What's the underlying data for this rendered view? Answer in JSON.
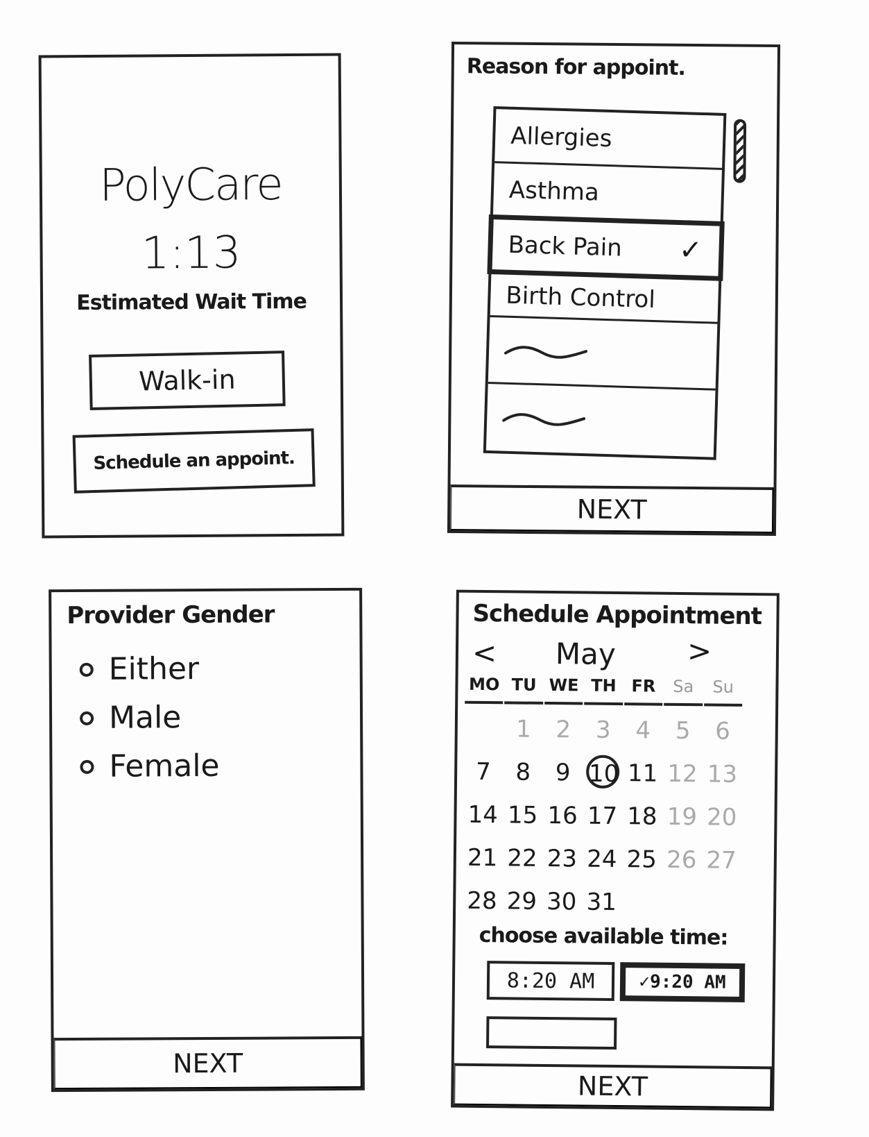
{
  "screen1": {
    "title": "PolyCare",
    "wait_time": "1:13",
    "wait_label": "Estimated Wait Time",
    "walkin_label": "Walk-in",
    "schedule_label": "Schedule an appoint."
  },
  "screen2": {
    "heading": "Reason for appoint.",
    "items": [
      {
        "label": "Allergies"
      },
      {
        "label": "Asthma"
      },
      {
        "label": "Back Pain",
        "selected": true
      },
      {
        "label": "Birth Control"
      }
    ],
    "check": "✓",
    "next_label": "NEXT"
  },
  "screen3": {
    "heading": "Provider Gender",
    "options": [
      "Either",
      "Male",
      "Female"
    ],
    "next_label": "NEXT"
  },
  "screen4": {
    "heading": "Schedule Appointment",
    "month": "May",
    "prev": "<",
    "next_arrow": ">",
    "weekdays": [
      "MO",
      "TU",
      "WE",
      "TH",
      "FR",
      "Sa",
      "Su"
    ],
    "weeks": [
      [
        "",
        "1",
        "2",
        "3",
        "4",
        "5",
        "6"
      ],
      [
        "7",
        "8",
        "9",
        "10",
        "11",
        "12",
        "13"
      ],
      [
        "14",
        "15",
        "16",
        "17",
        "18",
        "19",
        "20"
      ],
      [
        "21",
        "22",
        "23",
        "24",
        "25",
        "26",
        "27"
      ],
      [
        "28",
        "29",
        "30",
        "31",
        "",
        "",
        ""
      ]
    ],
    "selected_day": "10",
    "choose_label": "choose available time:",
    "times": [
      "8:20 AM",
      "✓9:20 AM"
    ],
    "selected_time": "✓9:20 AM",
    "next_label": "NEXT"
  }
}
